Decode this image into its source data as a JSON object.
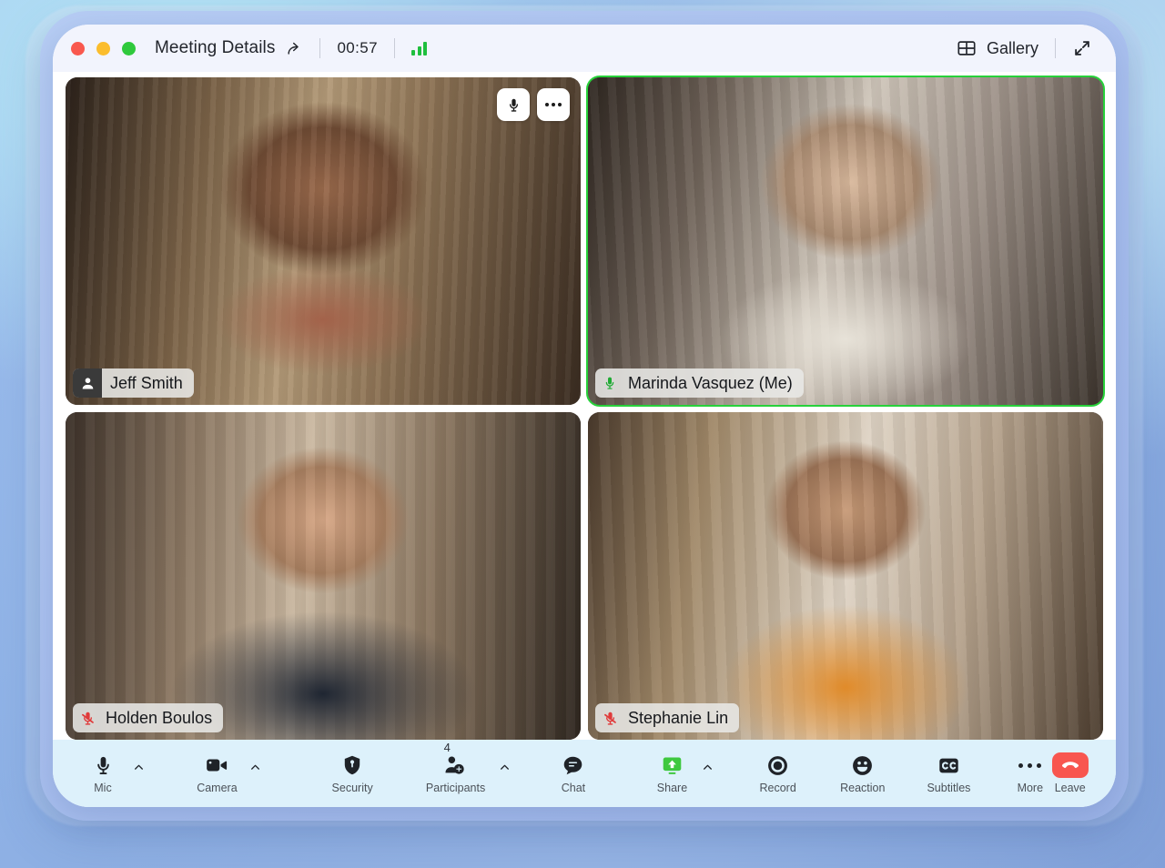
{
  "window": {
    "traffic_lights": [
      "close",
      "minimize",
      "maximize"
    ],
    "title": "Meeting Details",
    "share_icon": "share-arrow-icon",
    "timer": "00:57",
    "signal_icon": "signal-bars-icon",
    "signal_bars": 3,
    "view_mode_label": "Gallery",
    "view_mode_icon": "grid-icon",
    "expand_icon": "expand-arrows-icon"
  },
  "tile_controls": {
    "mic_icon": "microphone-icon",
    "more_icon": "ellipsis-icon"
  },
  "participants": [
    {
      "name": "Jeff Smith",
      "mic_state": "avatar",
      "mic_icon": "person-icon",
      "speaking": false,
      "theme": "jeff"
    },
    {
      "name": "Marinda Vasquez (Me)",
      "mic_state": "unmuted",
      "mic_icon": "microphone-icon",
      "speaking": true,
      "theme": "marinda"
    },
    {
      "name": "Holden Boulos",
      "mic_state": "muted",
      "mic_icon": "microphone-muted-icon",
      "speaking": false,
      "theme": "holden"
    },
    {
      "name": "Stephanie Lin",
      "mic_state": "muted",
      "mic_icon": "microphone-muted-icon",
      "speaking": false,
      "theme": "stephanie"
    }
  ],
  "toolbar": {
    "mic": {
      "label": "Mic",
      "icon": "microphone-icon",
      "has_caret": true
    },
    "camera": {
      "label": "Camera",
      "icon": "video-camera-icon",
      "has_caret": true
    },
    "security": {
      "label": "Security",
      "icon": "shield-icon",
      "has_caret": false
    },
    "participants": {
      "label": "Participants",
      "icon": "person-add-icon",
      "badge": "4",
      "has_caret": true
    },
    "chat": {
      "label": "Chat",
      "icon": "chat-bubble-icon",
      "has_caret": false
    },
    "share": {
      "label": "Share",
      "icon": "share-screen-icon",
      "has_caret": true
    },
    "record": {
      "label": "Record",
      "icon": "record-circle-icon",
      "has_caret": false
    },
    "reaction": {
      "label": "Reaction",
      "icon": "smiley-face-icon",
      "has_caret": false
    },
    "subtitles": {
      "label": "Subtitles",
      "icon": "closed-caption-icon",
      "has_caret": false
    },
    "more": {
      "label": "More",
      "icon": "ellipsis-icon",
      "has_caret": false
    },
    "leave": {
      "label": "Leave",
      "icon": "phone-hangup-icon",
      "has_caret": false
    }
  },
  "colors": {
    "accent_green": "#27d13a",
    "leave_red": "#f8564f",
    "toolbar_bg": "#ddf1fb",
    "titlebar_bg": "#f2f4fd",
    "share_green": "#3ec83f"
  }
}
